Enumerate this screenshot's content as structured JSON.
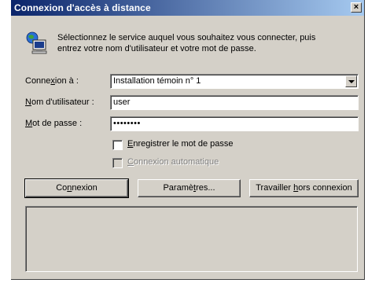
{
  "window": {
    "title": "Connexion d'accès à distance",
    "close_glyph": "×"
  },
  "info": {
    "icon": "network-computer-icon",
    "line1": "Sélectionnez le service auquel vous souhaitez vous connecter, puis",
    "line2": "entrez votre nom d'utilisateur et votre mot de passe."
  },
  "form": {
    "connection_label": {
      "before": "Conne",
      "accel": "x",
      "after": "ion à :"
    },
    "connection_value": "Installation témoin n° 1",
    "username_label": {
      "before": "",
      "accel": "N",
      "after": "om d'utilisateur :"
    },
    "username_value": "user",
    "password_label": {
      "before": "",
      "accel": "M",
      "after": "ot de passe :"
    },
    "password_value": "••••••••"
  },
  "options": {
    "save_password": {
      "before": "",
      "accel": "E",
      "after": "nregistrer le mot de passe",
      "checked": false
    },
    "auto_connect": {
      "before": "",
      "accel": "C",
      "after": "onnexion automatique",
      "checked": false,
      "disabled": true
    }
  },
  "buttons": {
    "connect": {
      "before": "Co",
      "accel": "n",
      "after": "nexion"
    },
    "settings": {
      "before": "Paramè",
      "accel": "t",
      "after": "res..."
    },
    "offline": {
      "before": "Travailler ",
      "accel": "h",
      "after": "ors connexion"
    }
  },
  "colors": {
    "title_start": "#0a246a",
    "title_end": "#a6caf0",
    "face": "#d4d0c8"
  }
}
